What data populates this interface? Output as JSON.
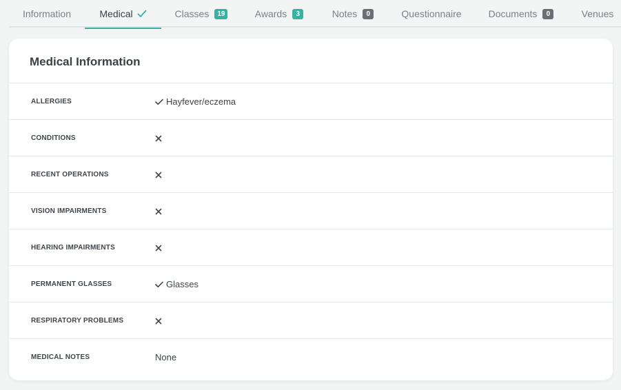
{
  "tabs": [
    {
      "label": "Information",
      "active": false
    },
    {
      "label": "Medical",
      "active": true,
      "icon": "check-icon"
    },
    {
      "label": "Classes",
      "active": false,
      "badge": "19",
      "badge_color": "#34b3a0"
    },
    {
      "label": "Awards",
      "active": false,
      "badge": "3",
      "badge_color": "#34b3a0"
    },
    {
      "label": "Notes",
      "active": false,
      "badge": "0",
      "badge_color": "#6a6f74"
    },
    {
      "label": "Questionnaire",
      "active": false
    },
    {
      "label": "Documents",
      "active": false,
      "badge": "0",
      "badge_color": "#6a6f74"
    },
    {
      "label": "Venues",
      "active": false
    }
  ],
  "card": {
    "title": "Medical Information",
    "rows": [
      {
        "label": "ALLERGIES",
        "icon": "check-icon",
        "value": "Hayfever/eczema"
      },
      {
        "label": "CONDITIONS",
        "icon": "cross-icon",
        "value": ""
      },
      {
        "label": "RECENT OPERATIONS",
        "icon": "cross-icon",
        "value": ""
      },
      {
        "label": "VISION IMPAIRMENTS",
        "icon": "cross-icon",
        "value": ""
      },
      {
        "label": "HEARING IMPAIRMENTS",
        "icon": "cross-icon",
        "value": ""
      },
      {
        "label": "PERMANENT GLASSES",
        "icon": "check-icon",
        "value": "Glasses"
      },
      {
        "label": "RESPIRATORY PROBLEMS",
        "icon": "cross-icon",
        "value": ""
      },
      {
        "label": "MEDICAL NOTES",
        "icon": "",
        "value": "None"
      }
    ]
  },
  "colors": {
    "accent": "#34b3a0",
    "badge_gray": "#6a6f74"
  }
}
